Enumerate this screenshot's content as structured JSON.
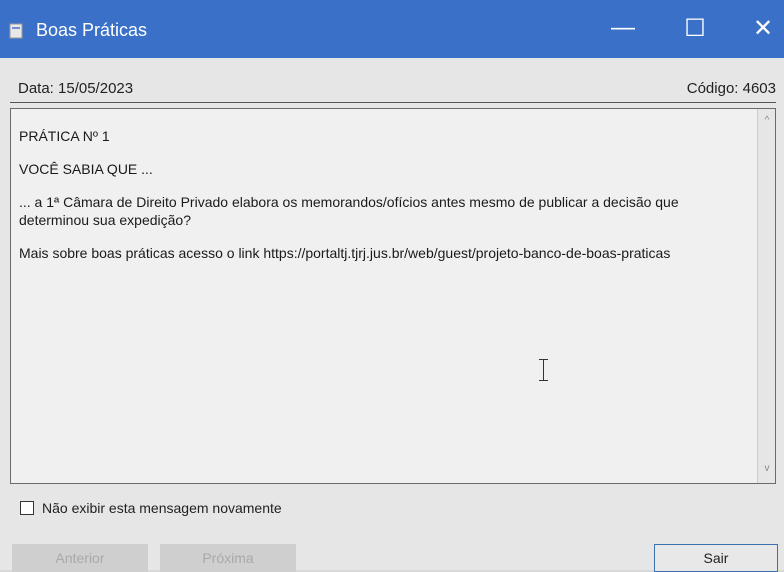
{
  "window": {
    "title": "Boas Práticas",
    "icon": "app-icon",
    "controls": {
      "minimize": "—",
      "maximize": "☐",
      "close": "✕"
    }
  },
  "header": {
    "date": "Data: 15/05/2023",
    "code": "Código: 4603"
  },
  "message": {
    "heading": "PRÁTICA Nº 1",
    "intro": "VOCÊ SABIA QUE ...",
    "body": "... a 1ª Câmara de Direito Privado elabora os memorandos/ofícios antes mesmo de publicar a decisão que determinou sua expedição?",
    "link_text": "Mais sobre boas práticas acesso o link https://portaltj.tjrj.jus.br/web/guest/projeto-banco-de-boas-praticas"
  },
  "checkbox": {
    "label": "Não exibir esta mensagem novamente",
    "checked": false
  },
  "buttons": {
    "previous": "Anterior",
    "next": "Próxima",
    "exit": "Sair"
  },
  "colors": {
    "titlebar": "#3a70c8",
    "background": "#e6e6e6",
    "exit_border": "#3a6fb0"
  }
}
